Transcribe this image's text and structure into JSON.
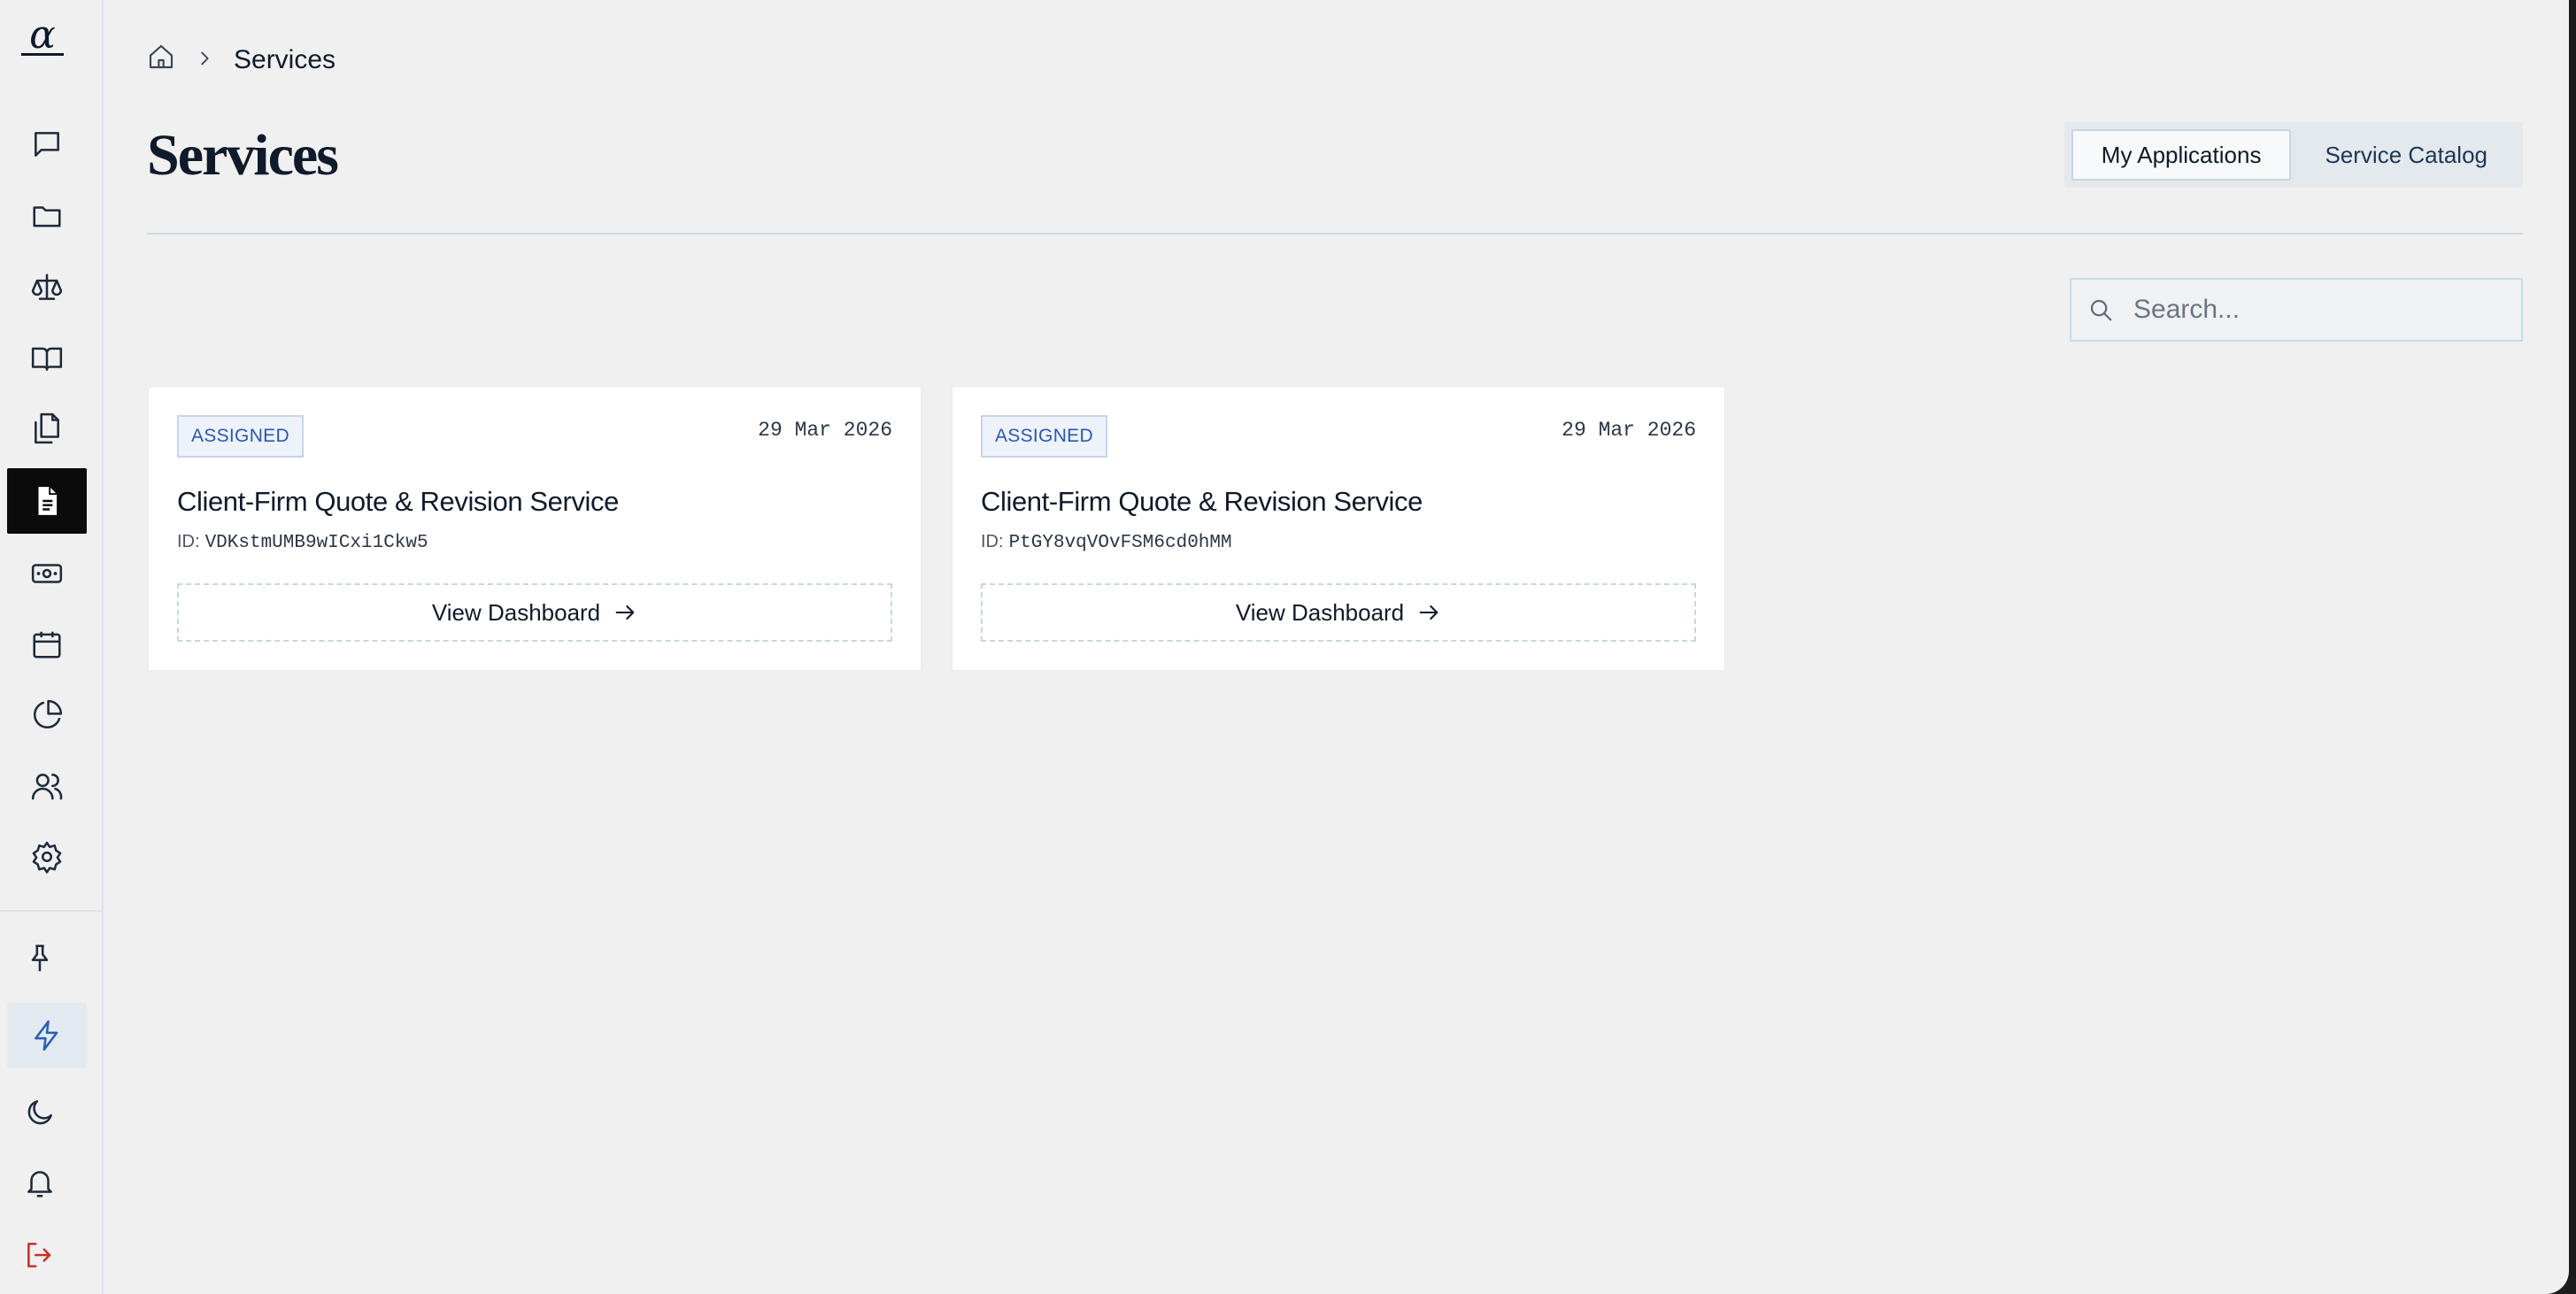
{
  "sidebar": {
    "logo_glyph": "α",
    "nav": [
      {
        "name": "messages",
        "icon": "chat-bubble-icon"
      },
      {
        "name": "folders",
        "icon": "folder-icon"
      },
      {
        "name": "legal",
        "icon": "scale-icon"
      },
      {
        "name": "library",
        "icon": "book-open-icon"
      },
      {
        "name": "documents",
        "icon": "copy-files-icon"
      },
      {
        "name": "services",
        "icon": "file-text-icon",
        "active": true
      },
      {
        "name": "billing",
        "icon": "banknote-icon"
      },
      {
        "name": "calendar",
        "icon": "calendar-icon"
      },
      {
        "name": "analytics",
        "icon": "pie-chart-icon"
      },
      {
        "name": "users",
        "icon": "users-icon"
      },
      {
        "name": "settings",
        "icon": "gear-icon"
      }
    ],
    "bottom": [
      {
        "name": "pin",
        "icon": "pin-icon"
      },
      {
        "name": "quick-actions",
        "icon": "lightning-icon"
      },
      {
        "name": "theme",
        "icon": "moon-icon"
      },
      {
        "name": "notifications",
        "icon": "bell-icon"
      },
      {
        "name": "logout",
        "icon": "logout-icon"
      }
    ]
  },
  "breadcrumb": {
    "home_icon": "home-icon",
    "current": "Services"
  },
  "page": {
    "title": "Services"
  },
  "tabs": {
    "my_applications": "My Applications",
    "service_catalog": "Service Catalog",
    "selected": "My Applications"
  },
  "search": {
    "placeholder": "Search...",
    "value": ""
  },
  "cards": [
    {
      "status": "ASSIGNED",
      "date": "29 Mar 2026",
      "title": "Client-Firm Quote & Revision Service",
      "id_label": "ID:",
      "id_value": "VDKstmUMB9wICxi1Ckw5",
      "action_label": "View Dashboard"
    },
    {
      "status": "ASSIGNED",
      "date": "29 Mar 2026",
      "title": "Client-Firm Quote & Revision Service",
      "id_label": "ID:",
      "id_value": "PtGY8vqVOvFSM6cd0hMM",
      "action_label": "View Dashboard"
    }
  ],
  "colors": {
    "accent": "#2b56b8",
    "active_nav": "#0b0b0b",
    "logout": "#c8302b",
    "background": "#f0f0f1"
  }
}
